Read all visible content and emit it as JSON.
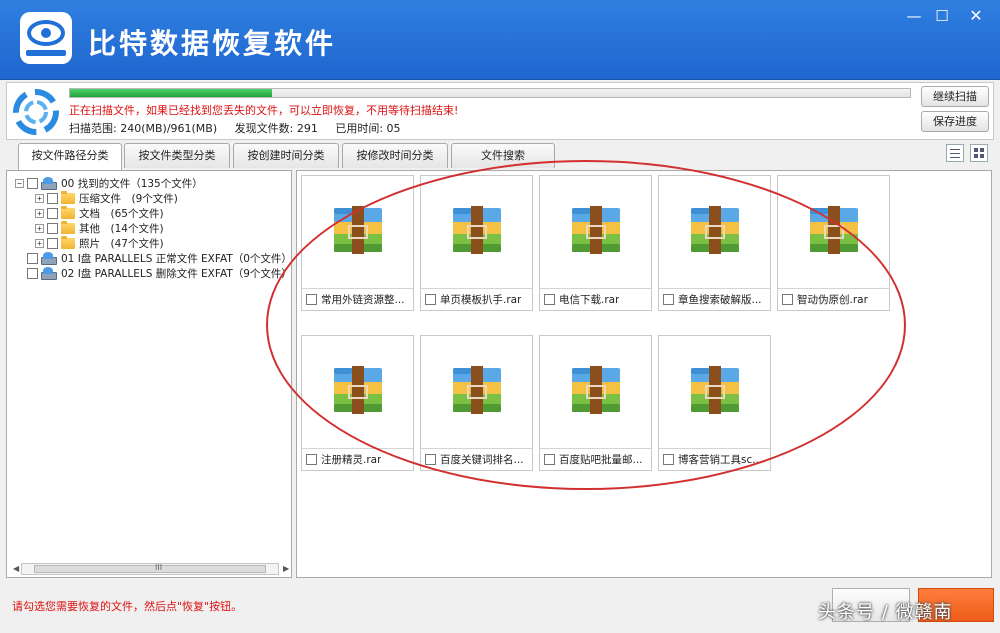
{
  "window": {
    "title": "比特数据恢复软件",
    "min_glyph": "—",
    "max_glyph": "☐",
    "close_glyph": "✕"
  },
  "status": {
    "progress_fraction": 0.24,
    "message": "正在扫描文件，如果已经找到您丢失的文件，可以立即恢复，不用等待扫描结束!",
    "scan_range": "扫描范围: 240(MB)/961(MB)",
    "files_found": "发现文件数: 291",
    "time_used": "已用时间: 05",
    "continue_label": "继续扫描",
    "save_label": "保存进度"
  },
  "tabs": [
    {
      "label": "按文件路径分类"
    },
    {
      "label": "按文件类型分类"
    },
    {
      "label": "按创建时间分类"
    },
    {
      "label": "按修改时间分类"
    },
    {
      "label": "文件搜索"
    }
  ],
  "tree": [
    {
      "text": "00 找到的文件（135个文件）"
    },
    {
      "text": "压缩文件　(9个文件)"
    },
    {
      "text": "文档　(65个文件)"
    },
    {
      "text": "其他　(14个文件)"
    },
    {
      "text": "照片　(47个文件)"
    },
    {
      "text": "01 I盘 PARALLELS 正常文件 EXFAT（0个文件）"
    },
    {
      "text": "02 I盘 PARALLELS 删除文件 EXFAT（9个文件）"
    }
  ],
  "tree_glyphs": {
    "minus": "−",
    "plus": "+",
    "left": "◀",
    "right": "▶",
    "grip": "III"
  },
  "files": [
    {
      "name": "常用外链资源整..."
    },
    {
      "name": "单页模板扒手.rar"
    },
    {
      "name": "电信下载.rar"
    },
    {
      "name": "章鱼搜索破解版..."
    },
    {
      "name": "智动伪原创.rar"
    },
    {
      "name": "注册精灵.rar"
    },
    {
      "name": "百度关键词排名..."
    },
    {
      "name": "百度贴吧批量邮..."
    },
    {
      "name": "博客营销工具sc..."
    }
  ],
  "footer": {
    "hint": "请勾选您需要恢复的文件，然后点\"恢复\"按钮。",
    "watermark": "头条号 / 微赣南"
  },
  "colors": {
    "title_bar": "#2a76dc",
    "progress": "#2bb34a",
    "warning_text": "#dd1111",
    "annotation_oval": "#d23030",
    "orange_button": "#f26420"
  }
}
